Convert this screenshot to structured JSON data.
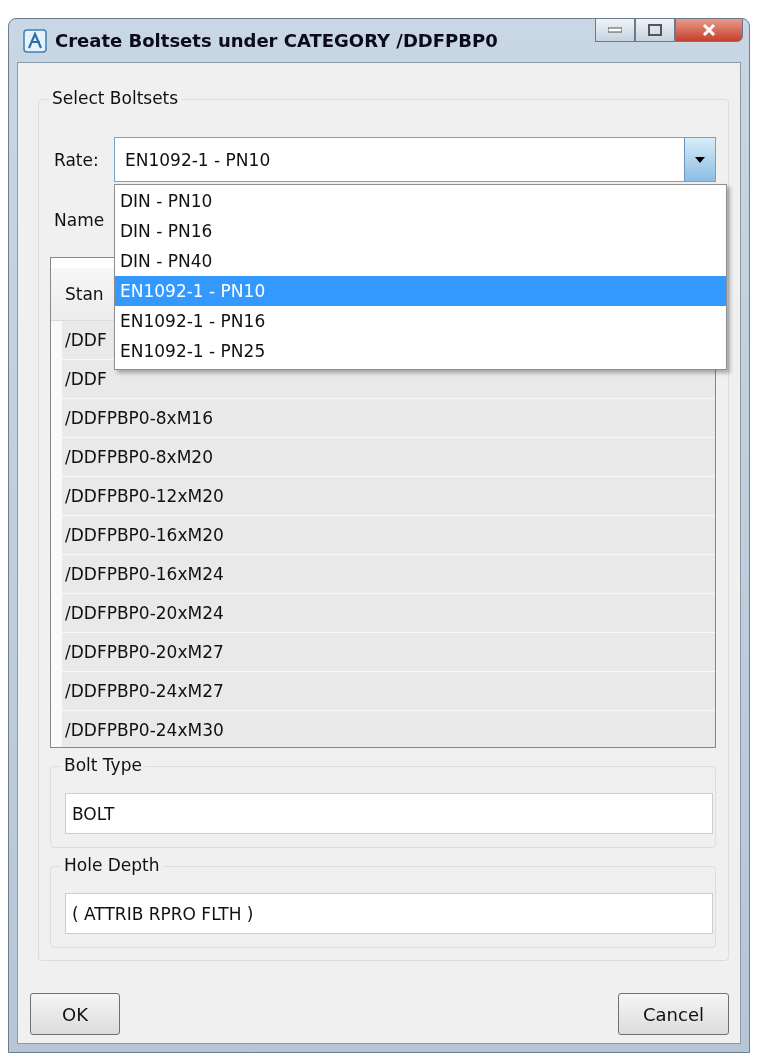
{
  "window": {
    "title": "Create Boltsets under CATEGORY /DDFPBP0"
  },
  "select_boltsets": {
    "title": "Select Boltsets",
    "rate": {
      "label": "Rate:",
      "value": "EN1092-1 - PN10",
      "expanded": true,
      "options": [
        {
          "label": "DIN - PN10",
          "selected": false
        },
        {
          "label": "DIN - PN16",
          "selected": false
        },
        {
          "label": "DIN - PN40",
          "selected": false
        },
        {
          "label": "EN1092-1 - PN10",
          "selected": true
        },
        {
          "label": "EN1092-1 - PN16",
          "selected": false
        },
        {
          "label": "EN1092-1 - PN25",
          "selected": false
        }
      ]
    },
    "name_label": "Name",
    "table": {
      "header": "Stan",
      "rows": [
        "/DDF",
        "/DDF",
        "/DDFPBP0-8xM16",
        "/DDFPBP0-8xM20",
        "/DDFPBP0-12xM20",
        "/DDFPBP0-16xM20",
        "/DDFPBP0-16xM24",
        "/DDFPBP0-20xM24",
        "/DDFPBP0-20xM27",
        "/DDFPBP0-24xM27",
        "/DDFPBP0-24xM30"
      ]
    },
    "bolt_type": {
      "title": "Bolt Type",
      "value": "BOLT"
    },
    "hole_depth": {
      "title": "Hole Depth",
      "value": "( ATTRIB RPRO FLTH )"
    }
  },
  "buttons": [
    "OK",
    "Cancel"
  ]
}
